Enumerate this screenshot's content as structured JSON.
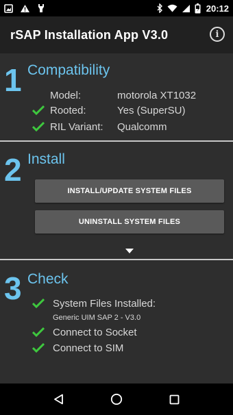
{
  "status_bar": {
    "time": "20:12",
    "left_icons": [
      "image-icon",
      "warning-icon",
      "usb-icon"
    ],
    "right_icons": [
      "bluetooth-icon",
      "wifi-icon",
      "signal-icon",
      "battery-icon"
    ]
  },
  "app_bar": {
    "title": "rSAP Installation App V3.0",
    "info_icon": "info-icon"
  },
  "compatibility": {
    "number": "1",
    "title": "Compatibility",
    "rows": [
      {
        "label": "Model:",
        "value": "motorola XT1032",
        "checked": false
      },
      {
        "label": "Rooted:",
        "value": "Yes (SuperSU)",
        "checked": true
      },
      {
        "label": "RIL Variant:",
        "value": "Qualcomm",
        "checked": true
      }
    ]
  },
  "install": {
    "number": "2",
    "title": "Install",
    "install_button": "INSTALL/UPDATE SYSTEM FILES",
    "uninstall_button": "UNINSTALL SYSTEM FILES",
    "expand_icon": "caret-down-icon"
  },
  "check": {
    "number": "3",
    "title": "Check",
    "items": [
      {
        "label": "System Files Installed:",
        "sub": "Generic UIM SAP 2 - V3.0",
        "checked": true
      },
      {
        "label": "Connect to Socket",
        "checked": true
      },
      {
        "label": "Connect to SIM",
        "checked": true
      }
    ]
  },
  "nav_bar": {
    "icons": [
      "back-icon",
      "home-icon",
      "recents-icon"
    ]
  },
  "colors": {
    "accent": "#6cc4ee",
    "check": "#3ec83e",
    "button": "#5a5a5a",
    "background": "#2e2e2e"
  }
}
